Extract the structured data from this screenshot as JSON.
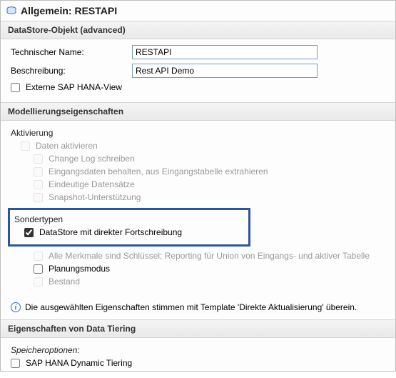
{
  "title": "Allgemein: RESTAPI",
  "sections": {
    "datastore": {
      "header": "DataStore-Objekt (advanced)",
      "tech_name_label": "Technischer Name:",
      "tech_name_value": "RESTAPI",
      "desc_label": "Beschreibung:",
      "desc_value": "Rest API Demo",
      "external_view_label": "Externe SAP HANA-View"
    },
    "modeling": {
      "header": "Modellierungseigenschaften",
      "activation_heading": "Aktivierung",
      "activate_data": "Daten aktivieren",
      "change_log": "Change Log schreiben",
      "keep_inbound": "Eingangsdaten behalten, aus Eingangstabelle extrahieren",
      "unique_records": "Eindeutige Datensätze",
      "snapshot": "Snapshot-Unterstützung",
      "special_heading": "Sondertypen",
      "direct_update": "DataStore mit direkter Fortschreibung",
      "all_keys": "Alle Merkmale sind Schlüssel; Reporting für Union von Eingangs- und aktiver Tabelle",
      "planning": "Planungsmodus",
      "inventory": "Bestand"
    },
    "info_text": "Die ausgewählten Eigenschaften stimmen mit Template 'Direkte Aktualisierung' überein.",
    "tiering": {
      "header": "Eigenschaften von Data Tiering",
      "storage_heading": "Speicheroptionen:",
      "dynamic_tiering": "SAP HANA Dynamic Tiering"
    }
  }
}
